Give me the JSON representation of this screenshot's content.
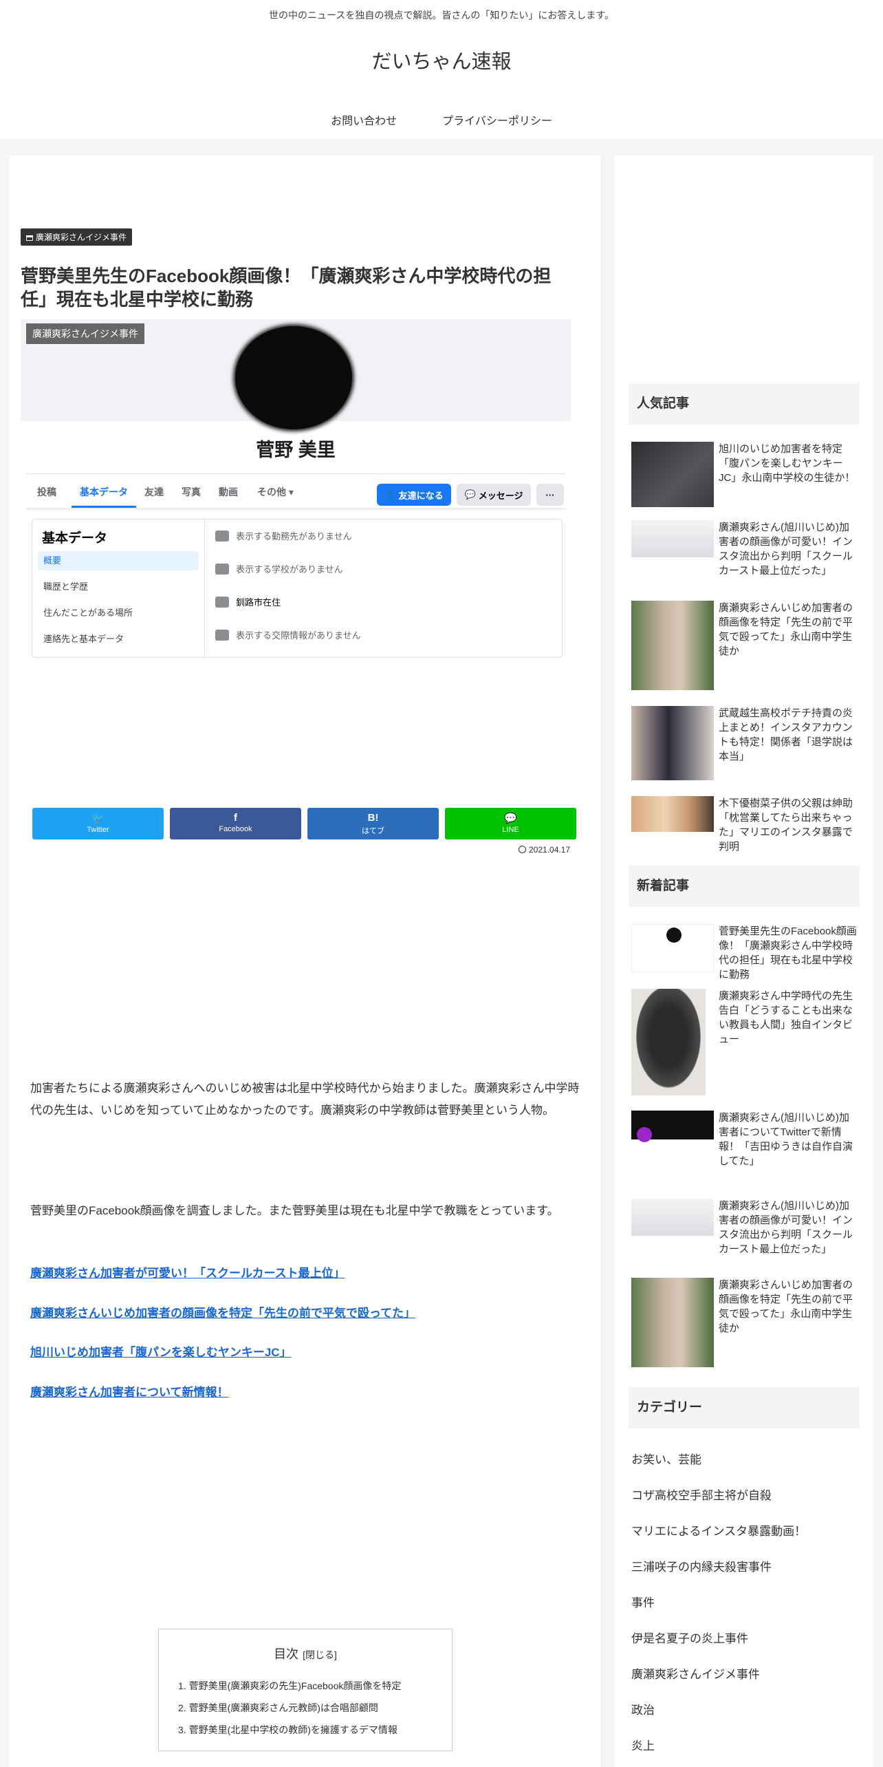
{
  "header": {
    "tagline": "世の中のニュースを独自の視点で解説。皆さんの「知りたい」にお答えします。",
    "site_title": "だいちゃん速報",
    "nav": [
      "お問い合わせ",
      "プライバシーポリシー"
    ]
  },
  "article": {
    "category": "廣瀬爽彩さんイジメ事件",
    "title": "菅野美里先生のFacebook顔画像！「廣瀬爽彩さん中学校時代の担任」現在も北星中学校に勤務",
    "eyecatch": {
      "label": "廣瀬爽彩さんイジメ事件",
      "fb_name": "菅野 美里",
      "tabs": [
        "投稿",
        "基本データ",
        "友達",
        "写真",
        "動画",
        "その他 ▾"
      ],
      "buttons": {
        "friend": "友達になる",
        "message": "メッセージ",
        "more": "···"
      },
      "panel_title": "基本データ",
      "panel_items": [
        "概要",
        "職歴と学歴",
        "住んだことがある場所",
        "連絡先と基本データ"
      ],
      "rows": [
        "表示する勤務先がありません",
        "表示する学校がありません",
        "釧路市在住",
        "表示する交際情報がありません"
      ]
    },
    "share": [
      {
        "glyph": "🐦",
        "label": "Twitter",
        "color": "#1da1f2"
      },
      {
        "glyph": "f",
        "label": "Facebook",
        "color": "#3b5998"
      },
      {
        "glyph": "B!",
        "label": "はてブ",
        "color": "#2c6ebd"
      },
      {
        "glyph": "💬",
        "label": "LINE",
        "color": "#00c300"
      }
    ],
    "date": "2021.04.17",
    "paragraphs": [
      "加害者たちによる廣瀬爽彩さんへのいじめ被害は北星中学校時代から始まりました。廣瀬爽彩さん中学時代の先生は、いじめを知っていて止めなかったのです。廣瀬爽彩の中学教師は菅野美里という人物。",
      "菅野美里のFacebook顔画像を調査しました。また菅野美里は現在も北星中学で教職をとっています。"
    ],
    "links": [
      "廣瀬爽彩さん加害者が可愛い！「スクールカースト最上位」",
      "廣瀬爽彩さんいじめ加害者の顔画像を特定「先生の前で平気で殴ってた」",
      "旭川いじめ加害者「腹パンを楽しむヤンキーJC」",
      "廣瀬爽彩さん加害者について新情報！"
    ],
    "toc": {
      "title": "目次",
      "close": "[閉じる]",
      "items": [
        "1. 菅野美里(廣瀬爽彩の先生)Facebook顔画像を特定",
        "2. 菅野美里(廣瀬爽彩さん元教師)は合唱部顧問",
        "3. 菅野美里(北星中学校の教師)を擁護するデマ情報"
      ]
    }
  },
  "sidebar": {
    "popular_title": "人気記事",
    "popular": [
      "旭川のいじめ加害者を特定「腹パンを楽しむヤンキーJC」永山南中学校の生徒か！",
      "廣瀬爽彩さん(旭川いじめ)加害者の顔画像が可愛い！インスタ流出から判明「スクールカースト最上位だった」",
      "廣瀬爽彩さんいじめ加害者の顔画像を特定「先生の前で平気で殴ってた」永山南中学生徒か",
      "武蔵越生高校ポテチ持責の炎上まとめ！インスタアカウントも特定！関係者「退学説は本当」",
      "木下優樹菜子供の父親は紳助「枕営業してたら出来ちゃった」マリエのインスタ暴露で判明"
    ],
    "new_title": "新着記事",
    "new": [
      "菅野美里先生のFacebook顔画像！「廣瀬爽彩さん中学校時代の担任」現在も北星中学校に勤務",
      "廣瀬爽彩さん中学時代の先生告白「どうすることも出来ない教員も人間」独自インタビュー",
      "廣瀬爽彩さん(旭川いじめ)加害者についてTwitterで新情報！「吉田ゆうきは自作自演してた」",
      "廣瀬爽彩さん(旭川いじめ)加害者の顔画像が可愛い！インスタ流出から判明「スクールカースト最上位だった」",
      "廣瀬爽彩さんいじめ加害者の顔画像を特定「先生の前で平気で殴ってた」永山南中学生徒か"
    ],
    "category_title": "カテゴリー",
    "categories": [
      "お笑い、芸能",
      "コザ高校空手部主将が自殺",
      "マリエによるインスタ暴露動画！",
      "三浦咲子の内縁夫殺害事件",
      "事件",
      "伊是名夏子の炎上事件",
      "廣瀬爽彩さんイジメ事件",
      "政治",
      "炎上"
    ]
  }
}
